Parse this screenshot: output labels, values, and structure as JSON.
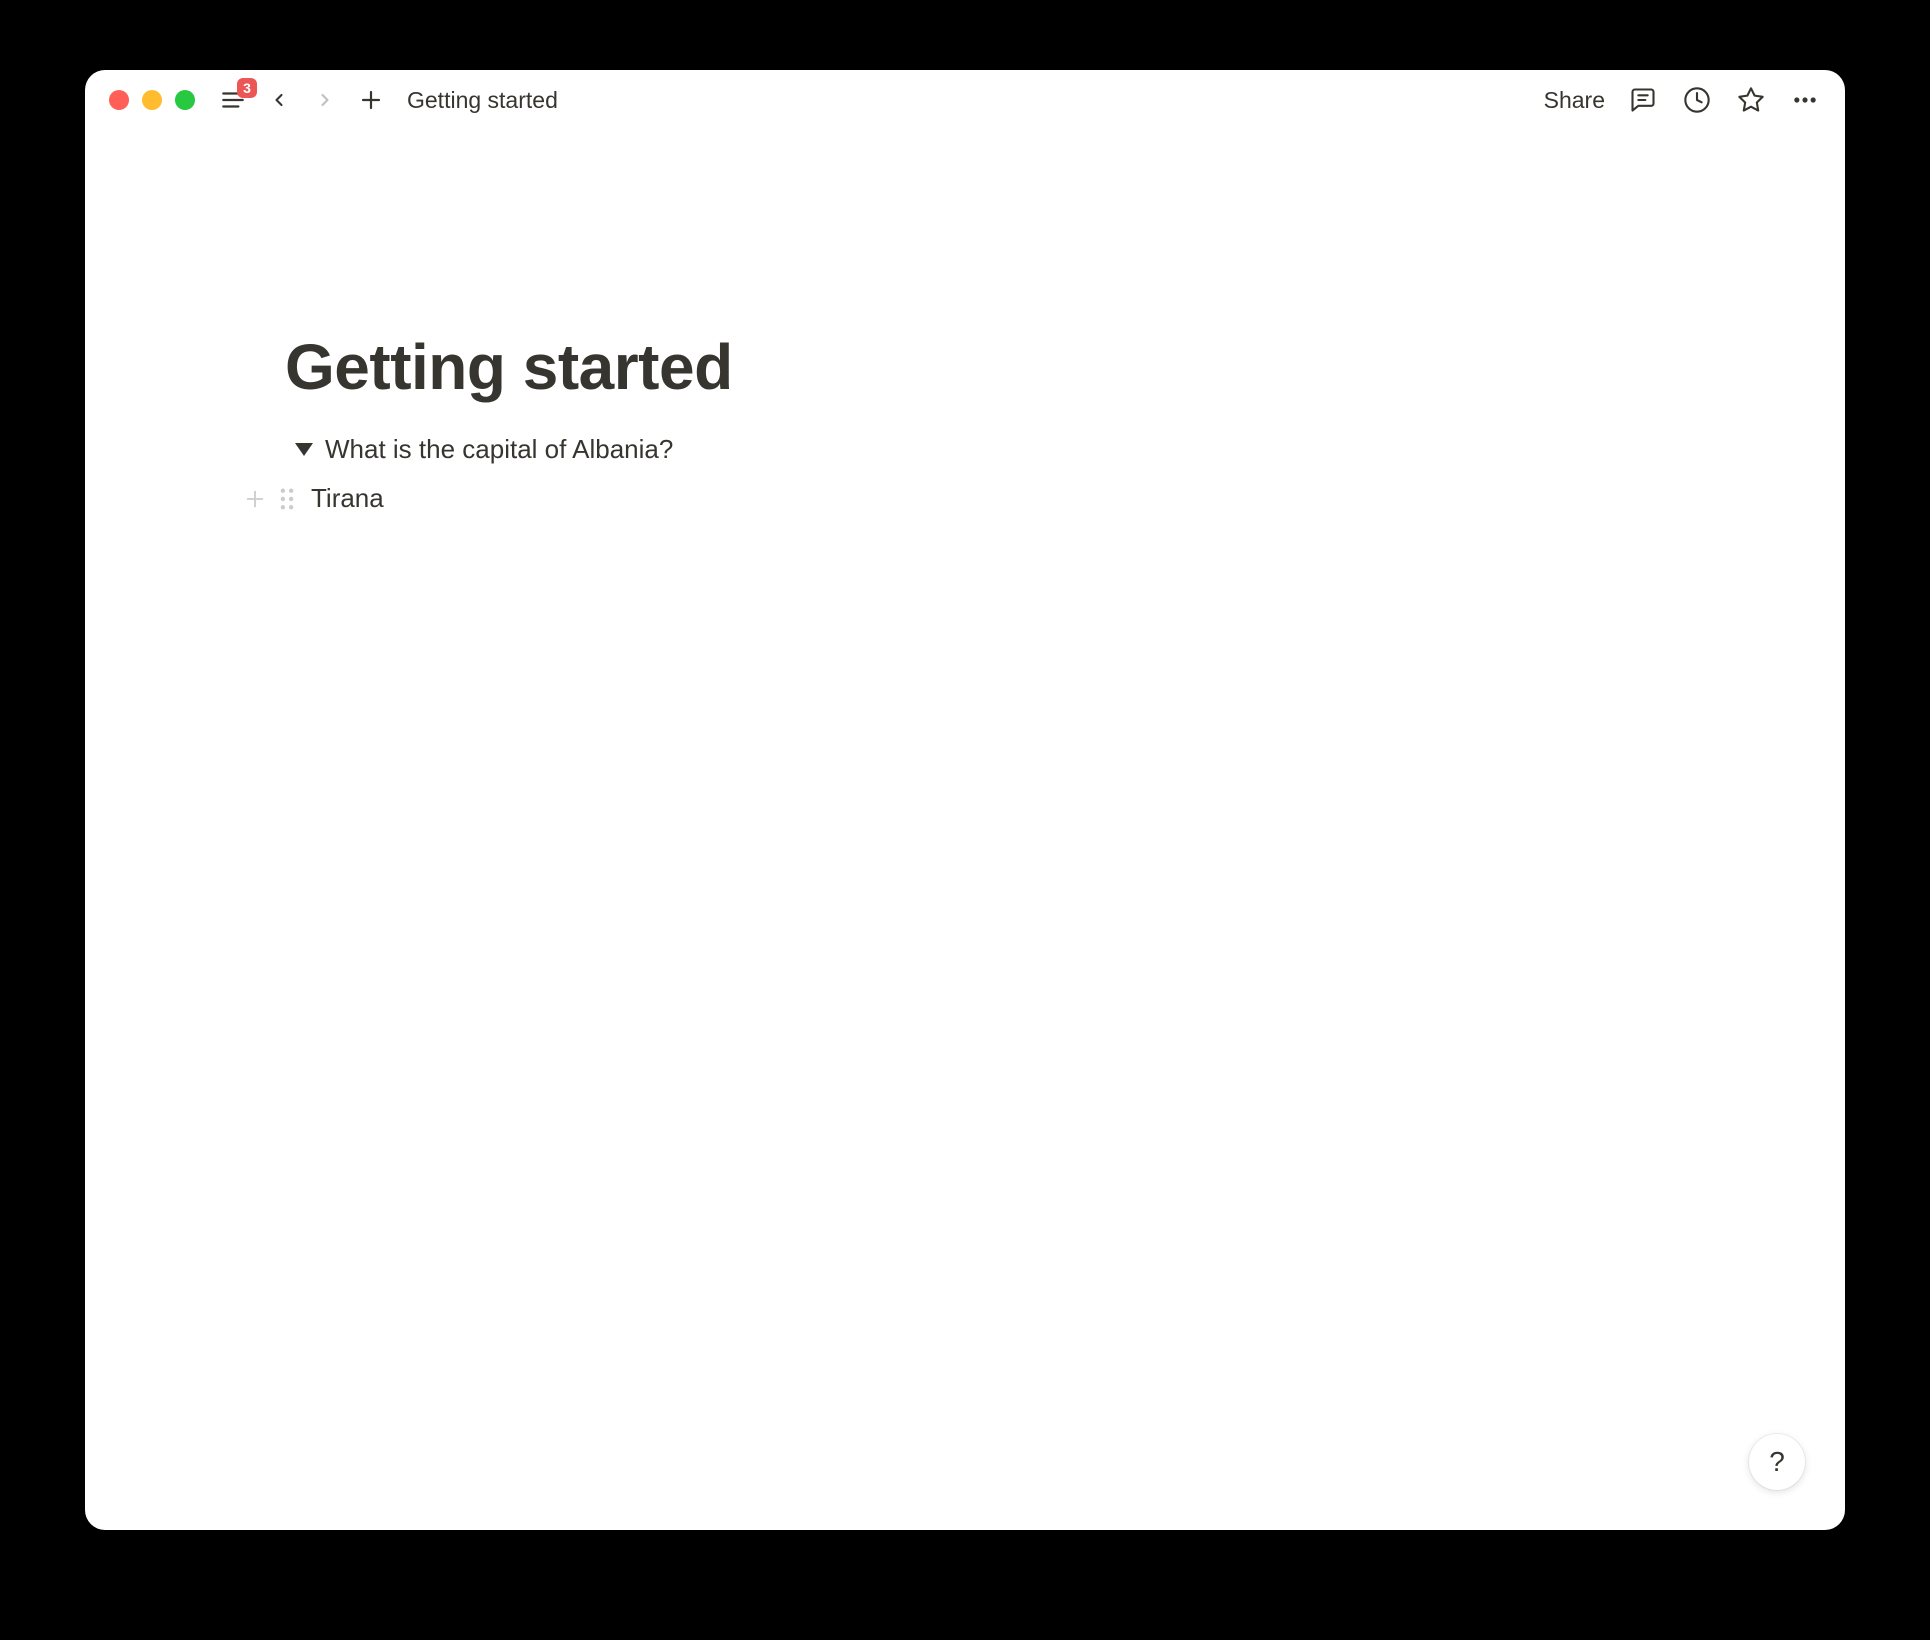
{
  "topbar": {
    "notification_count": "3",
    "breadcrumb": "Getting started",
    "share_label": "Share"
  },
  "page": {
    "title": "Getting started",
    "toggle_heading": "What is the capital of Albania?",
    "toggle_content": "Tirana"
  },
  "help": {
    "label": "?"
  }
}
